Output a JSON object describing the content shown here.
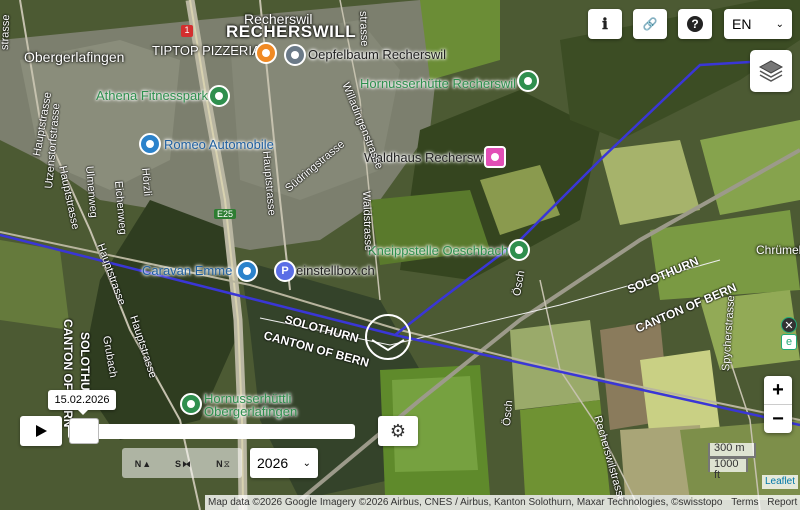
{
  "map": {
    "town_label": "RECHERSWILL",
    "places": [
      {
        "id": "recherswil",
        "text": "Recherswil"
      },
      {
        "id": "obergerlafingen",
        "text": "Obergerlafingen"
      },
      {
        "id": "tiptop",
        "text": "TIPTOP PIZZERIA"
      },
      {
        "id": "oepfelbaum",
        "text": "Oepfelbaum Recherswil"
      },
      {
        "id": "hornusserhuette",
        "text": "Hornusserhütte Recherswil"
      },
      {
        "id": "athena",
        "text": "Athena Fitnesspark"
      },
      {
        "id": "romeo",
        "text": "Romeo Automobile"
      },
      {
        "id": "waldhaus",
        "text": "Waldhaus Recherswil"
      },
      {
        "id": "kneipp",
        "text": "Kneippstelle Oeschbach"
      },
      {
        "id": "caravan",
        "text": "Caravan Emme"
      },
      {
        "id": "einstell",
        "text": "einstellbox.ch"
      },
      {
        "id": "hornusserhuettli",
        "text": "Hornusserhüttli Obergerlafingen"
      },
      {
        "id": "chruemel",
        "text": "Chrümel"
      }
    ],
    "canton_labels": {
      "solothurn_left": "SOLOTHURN",
      "bern_left": "CANTON OF BERN",
      "solothurn_right": "SOLOTHURN",
      "bern_right": "CANTON OF BERN",
      "solothurn_vert": "SOLOTHURN",
      "bern_vert": "CANTON OF BERN"
    },
    "streets": {
      "hauptstrasse_a": "Hauptstrasse",
      "hauptstrasse_b": "Hauptstrasse",
      "hauptstrasse_c": "Hauptstrasse",
      "hauptstrasse_d": "Hauptstrasse",
      "hauptstrasse_e": "Hauptstrasse",
      "utzenstorf": "Utzenstorfstrasse",
      "ulmenweg": "Ulmenweg",
      "eichenweg": "Eichenweg",
      "hoerzli": "Hörzli",
      "suedringstrasse": "Südringstrasse",
      "waldstrasse": "Waldstrasse",
      "willadingenstrasse": "Willadingenstrasse",
      "grubach": "Grubach",
      "recherswilstrasse": "Recherswilstrasse",
      "spycherstrasse": "Spycherstrasse",
      "osch_a": "Ösch",
      "osch_b": "Ösch",
      "e25": "E25",
      "road_1": "1",
      "istrasse": "strasse",
      "gstrasse": "strasse"
    }
  },
  "toolbar": {
    "info_label": "ℹ",
    "link_label": "🔗",
    "help_label": "?",
    "language": "EN"
  },
  "timeline": {
    "date": "15.02.2026",
    "year": "2026",
    "mode_labels": [
      "N",
      "S",
      "N"
    ]
  },
  "zoom": {
    "in": "+",
    "out": "−"
  },
  "scale": {
    "metric": "300 m",
    "imperial": "1000 ft"
  },
  "attribution": {
    "leaflet": "Leaflet",
    "text": "Map data ©2026 Google Imagery ©2026 Airbus, CNES / Airbus, Kanton Solothurn, Maxar Technologies, ©swisstopo",
    "terms": "Terms",
    "report": "Report a map error"
  },
  "colors": {
    "route": "#3a36d6",
    "poi_green": "#2f8f4e",
    "poi_gray": "#6b7a88",
    "poi_blue": "#2b82cb",
    "poi_orange": "#f08a24",
    "poi_pink": "#e24fb6",
    "poi_parking": "#5b6ee6"
  }
}
